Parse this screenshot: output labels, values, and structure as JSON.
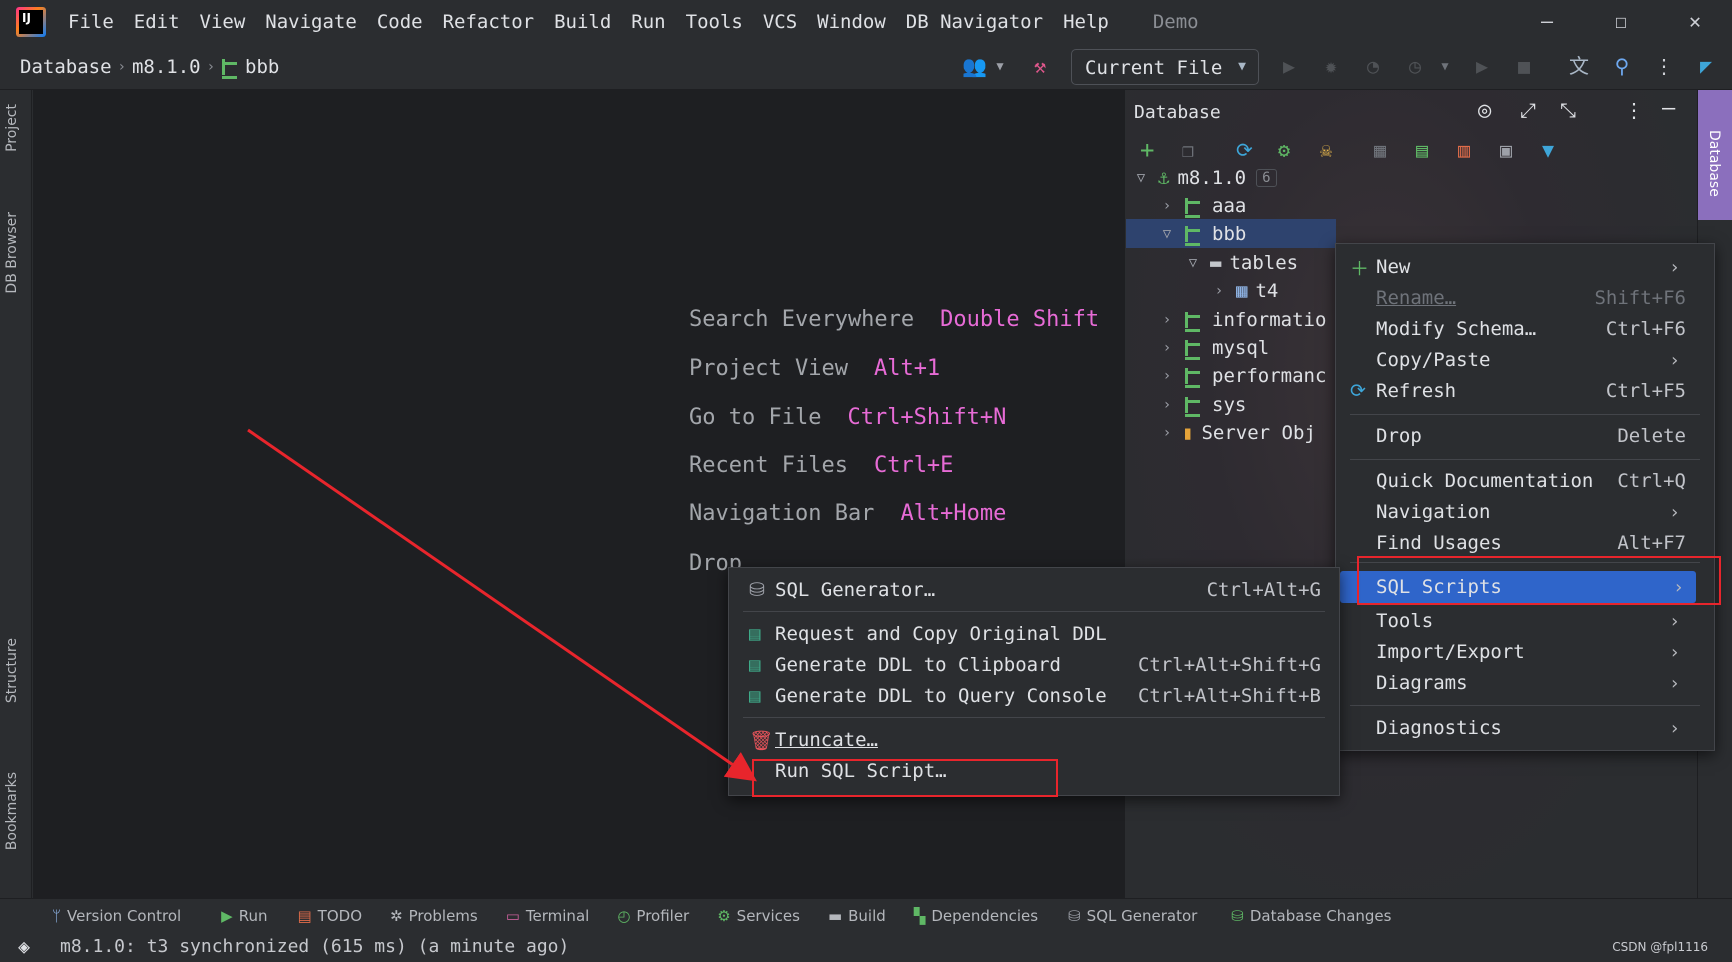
{
  "app": {
    "menu": [
      "File",
      "Edit",
      "View",
      "Navigate",
      "Code",
      "Refactor",
      "Build",
      "Run",
      "Tools",
      "VCS",
      "Window",
      "DB Navigator",
      "Help"
    ],
    "project_name": "Demo",
    "window_controls": {
      "minimize": "—",
      "maximize": "☐",
      "close": "✕"
    }
  },
  "breadcrumb": {
    "items": [
      "Database",
      "m8.1.0",
      "bbb"
    ]
  },
  "run_config": {
    "label": "Current File"
  },
  "left_tool_windows": [
    "Project",
    "DB Browser",
    "Structure",
    "Bookmarks"
  ],
  "editor_hints": [
    {
      "action": "Search Everywhere",
      "shortcut": "Double Shift"
    },
    {
      "action": "Project View",
      "shortcut": "Alt+1"
    },
    {
      "action": "Go to File",
      "shortcut": "Ctrl+Shift+N"
    },
    {
      "action": "Recent Files",
      "shortcut": "Ctrl+E"
    },
    {
      "action": "Navigation Bar",
      "shortcut": "Alt+Home"
    },
    {
      "action": "Drop",
      "shortcut": ""
    }
  ],
  "database_panel": {
    "title": "Database",
    "side_tab": "Database",
    "tree": [
      {
        "label": "m8.1.0",
        "badge": "6",
        "expanded": true
      },
      {
        "label": "aaa",
        "expanded": false
      },
      {
        "label": "bbb",
        "expanded": true,
        "selected": true
      },
      {
        "label": "tables",
        "expanded": true
      },
      {
        "label": "t4",
        "expanded": false
      },
      {
        "label": "informatio",
        "expanded": false
      },
      {
        "label": "mysql",
        "expanded": false
      },
      {
        "label": "performanc",
        "expanded": false
      },
      {
        "label": "sys",
        "expanded": false
      },
      {
        "label": "Server Obj",
        "expanded": false
      }
    ]
  },
  "context_menu": {
    "items": [
      {
        "label": "New",
        "shortcut": "",
        "submenu": true
      },
      {
        "label": "Rename…",
        "shortcut": "Shift+F6",
        "disabled": true
      },
      {
        "label": "Modify Schema…",
        "shortcut": "Ctrl+F6"
      },
      {
        "label": "Copy/Paste",
        "shortcut": "",
        "submenu": true
      },
      {
        "label": "Refresh",
        "shortcut": "Ctrl+F5"
      },
      {
        "label": "Drop",
        "shortcut": "Delete"
      },
      {
        "label": "Quick Documentation",
        "shortcut": "Ctrl+Q"
      },
      {
        "label": "Navigation",
        "shortcut": "",
        "submenu": true
      },
      {
        "label": "Find Usages",
        "shortcut": "Alt+F7"
      },
      {
        "label": "SQL Scripts",
        "shortcut": "",
        "submenu": true,
        "highlighted": true
      },
      {
        "label": "Tools",
        "shortcut": "",
        "submenu": true
      },
      {
        "label": "Import/Export",
        "shortcut": "",
        "submenu": true
      },
      {
        "label": "Diagrams",
        "shortcut": "",
        "submenu": true
      },
      {
        "label": "Diagnostics",
        "shortcut": "",
        "submenu": true
      }
    ]
  },
  "sql_scripts_submenu": {
    "items": [
      {
        "label": "SQL Generator…",
        "shortcut": "Ctrl+Alt+G"
      },
      {
        "label": "Request and Copy Original DDL",
        "shortcut": ""
      },
      {
        "label": "Generate DDL to Clipboard",
        "shortcut": "Ctrl+Alt+Shift+G"
      },
      {
        "label": "Generate DDL to Query Console",
        "shortcut": "Ctrl+Alt+Shift+B"
      },
      {
        "label": "Truncate…",
        "shortcut": ""
      },
      {
        "label": "Run SQL Script…",
        "shortcut": ""
      }
    ]
  },
  "bottom_tools": [
    "Version Control",
    "Run",
    "TODO",
    "Problems",
    "Terminal",
    "Profiler",
    "Services",
    "Build",
    "Dependencies",
    "SQL Generator",
    "Database Changes"
  ],
  "status": {
    "message": "m8.1.0: t3 synchronized (615 ms) (a minute ago)",
    "watermark": "CSDN @fpl1116"
  },
  "colors": {
    "accent": "#e76bd6",
    "selection": "#2e436e",
    "highlight": "#2f65ca",
    "annotation": "#e8252c"
  }
}
